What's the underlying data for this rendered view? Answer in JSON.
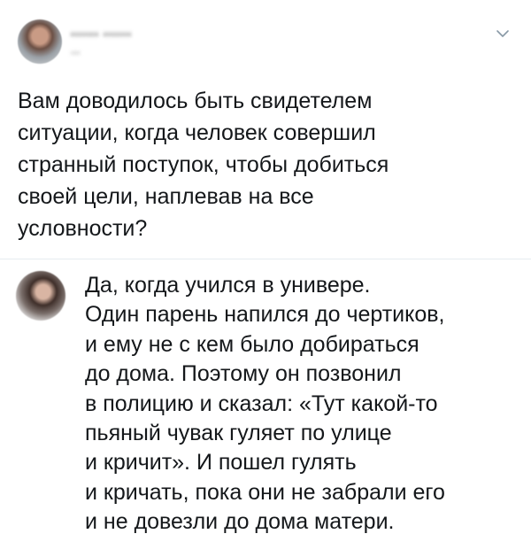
{
  "tweet": {
    "author_name": "ʻʻʻʻʻʻʻ ʻʻʻʻʻʻʻ",
    "author_handle": "ʻʻʻʻ",
    "text_lines": [
      "Вам доводилось быть свидетелем",
      "ситуации, когда человек совершил",
      "странный поступок, чтобы добиться",
      "своей цели, наплевав на все",
      "условности?"
    ]
  },
  "reply": {
    "text_lines": [
      "Да, когда учился в универе.",
      "Один парень напился до чертиков,",
      "и ему не с кем было добираться",
      "до дома. Поэтому он позвонил",
      "в полицию и сказал: «Тут какой-то",
      "пьяный чувак гуляет по улице",
      "и кричит». И пошел гулять",
      "и кричать, пока они не забрали его",
      "и не довезли до дома матери."
    ]
  },
  "icons": {
    "menu_caret": "chevron-down-icon"
  },
  "colors": {
    "text": "#14171a",
    "divider": "#e6ecf0",
    "caret": "#8899a6"
  }
}
